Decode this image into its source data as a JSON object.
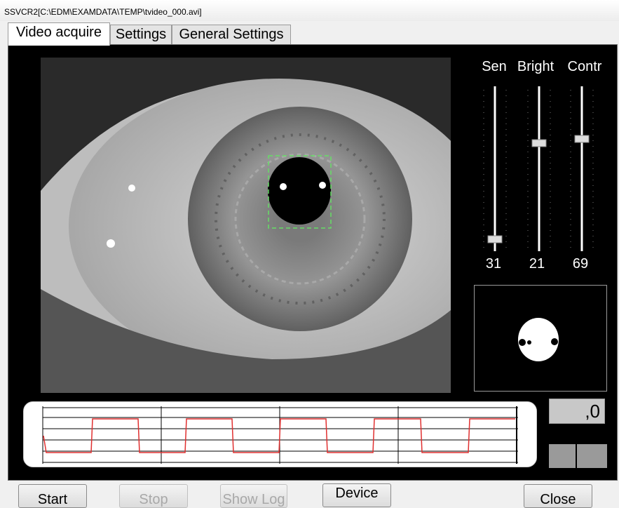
{
  "window": {
    "title": "SSVCR2[C:\\EDM\\EXAMDATA\\TEMP\\tvideo_000.avi]"
  },
  "tabs": [
    {
      "label": "Video acquire",
      "active": true
    },
    {
      "label": "Settings",
      "active": false
    },
    {
      "label": "General Settings",
      "active": false
    }
  ],
  "sliders": [
    {
      "label": "Sen",
      "value": "31"
    },
    {
      "label": "Bright",
      "value": "21"
    },
    {
      "label": "Contr",
      "value": "69"
    }
  ],
  "readout": {
    "value": ",0"
  },
  "buttons": {
    "start": "Start",
    "stop": "Stop",
    "show_log": "Show Log",
    "device": "Device",
    "close": "Close"
  },
  "colors": {
    "panel_bg": "#000000",
    "waveform_line": "#e03030",
    "roi_box": "#66dd66"
  }
}
